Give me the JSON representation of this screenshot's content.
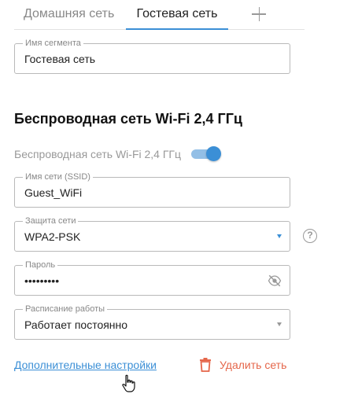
{
  "tabs": {
    "home": "Домашняя сеть",
    "guest": "Гостевая сеть",
    "active": "guest",
    "add_icon": "plus-icon"
  },
  "segment": {
    "label": "Имя сегмента",
    "value": "Гостевая сеть"
  },
  "wifi": {
    "section_title": "Беспроводная сеть Wi-Fi 2,4 ГГц",
    "toggle_label": "Беспроводная сеть Wi-Fi 2,4 ГГц",
    "enabled": true,
    "ssid": {
      "label": "Имя сети (SSID)",
      "value": "Guest_WiFi"
    },
    "security": {
      "label": "Защита сети",
      "value": "WPA2-PSK",
      "help_icon": "help-icon",
      "help_text": "?"
    },
    "password": {
      "label": "Пароль",
      "value": "•••••••••",
      "visibility_icon": "eye-off-icon"
    },
    "schedule": {
      "label": "Расписание работы",
      "value": "Работает постоянно"
    }
  },
  "actions": {
    "advanced_settings": "Дополнительные настройки",
    "delete_network": "Удалить сеть",
    "delete_icon": "trash-icon"
  },
  "colors": {
    "accent": "#3b8fd6",
    "danger": "#e5664a",
    "muted": "#999999"
  }
}
